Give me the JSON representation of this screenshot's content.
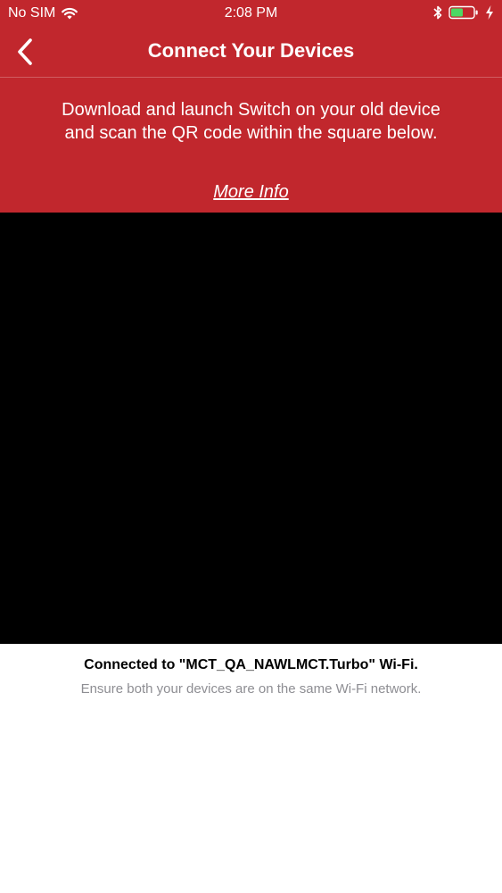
{
  "status_bar": {
    "carrier": "No SIM",
    "time": "2:08 PM",
    "wifi_icon": "wifi-icon",
    "bluetooth_icon": "bluetooth-icon",
    "battery_icon": "battery-icon",
    "charging_icon": "charging-bolt-icon"
  },
  "nav": {
    "back_icon": "chevron-left-icon",
    "title": "Connect Your Devices"
  },
  "instructions": {
    "text": "Download and launch Switch on your old device and scan the QR code within the square below.",
    "more_info_label": "More Info"
  },
  "footer": {
    "connection_status": "Connected to \"MCT_QA_NAWLMCT.Turbo\" Wi-Fi.",
    "hint": "Ensure both your devices are on the same Wi-Fi network."
  },
  "colors": {
    "brand_red": "#c1272d",
    "camera_background": "#000000",
    "battery_fill": "#4cd964",
    "hint_gray": "#8e8e93"
  }
}
